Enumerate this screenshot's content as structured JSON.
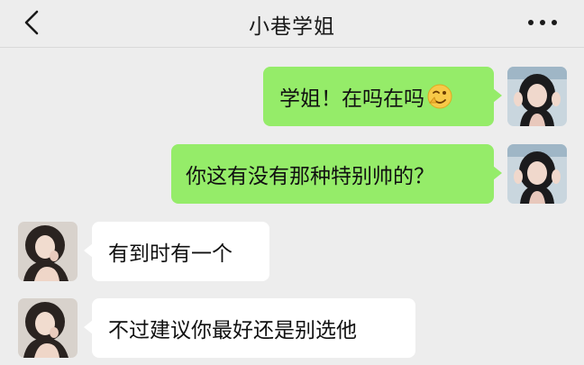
{
  "header": {
    "title": "小巷学姐",
    "back_icon": "chevron-left-icon",
    "more_icon": "more-dots-icon"
  },
  "messages": [
    {
      "sender": "me",
      "text": "学姐！在吗在吗",
      "emoji": "wink-emoji-icon"
    },
    {
      "sender": "me",
      "text": "你这有没有那种特别帅的？"
    },
    {
      "sender": "other",
      "text": "有到时有一个"
    },
    {
      "sender": "other",
      "text": "不过建议你最好还是别选他"
    }
  ],
  "colors": {
    "background": "#ededed",
    "my_bubble": "#95ec69",
    "other_bubble": "#ffffff",
    "text": "#111111"
  }
}
